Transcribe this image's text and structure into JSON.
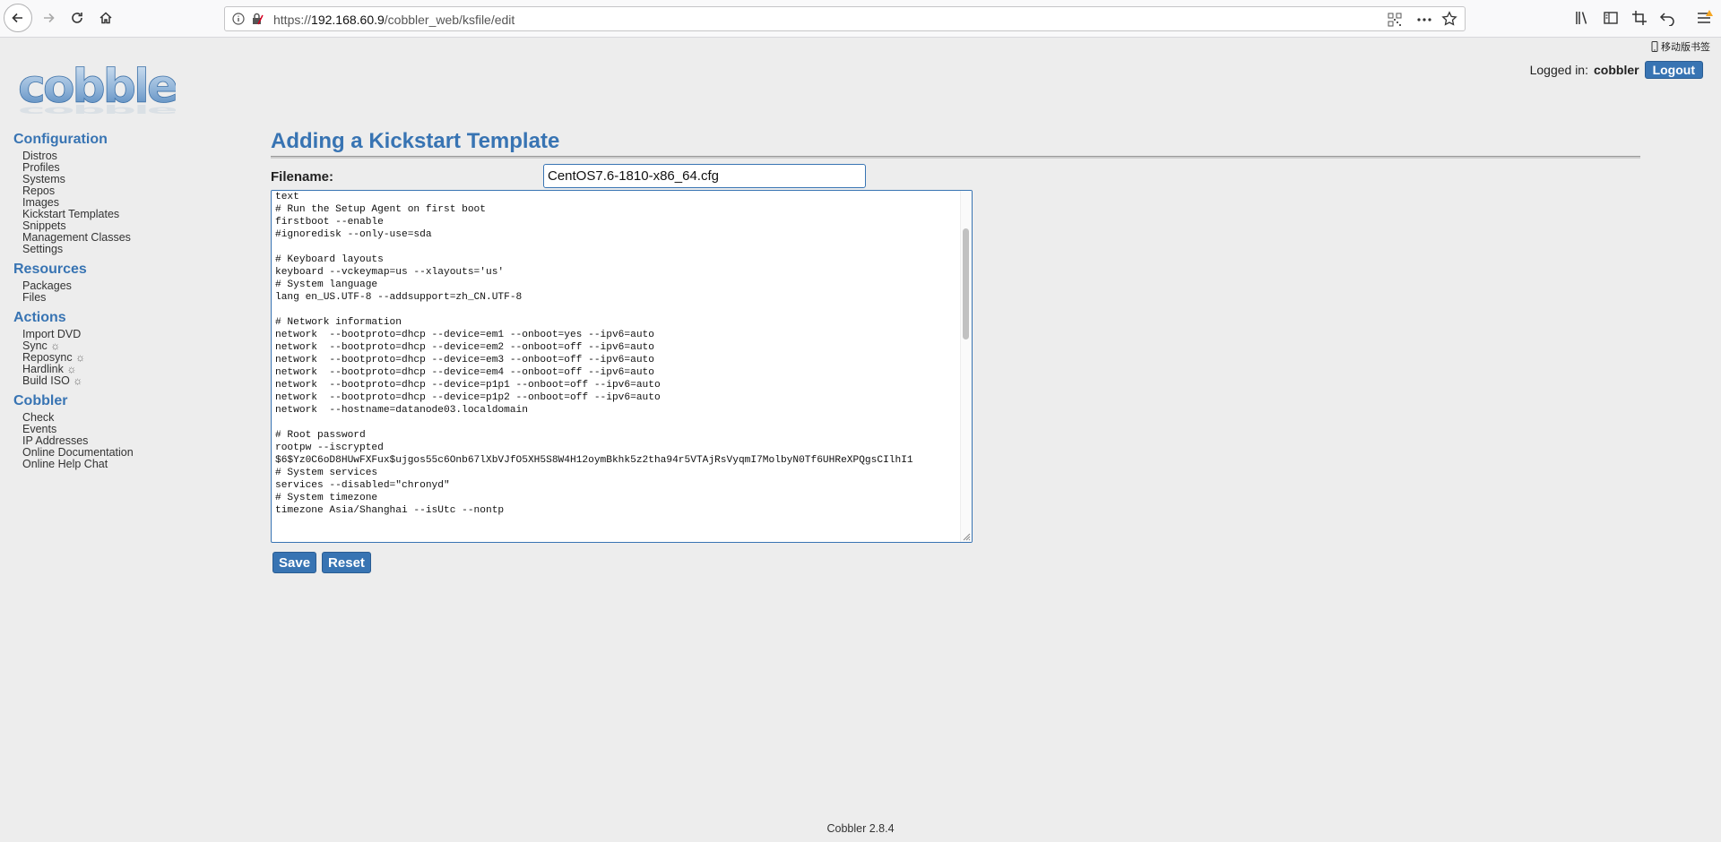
{
  "browser": {
    "url_scheme": "https://",
    "url_host": "192.168.60.9",
    "url_path": "/cobbler_web/ksfile/edit",
    "bookmark_label": "移动版书签"
  },
  "header": {
    "logo_alt": "cobbler",
    "logged_in_label": "Logged in:",
    "username": "cobbler",
    "logout_label": "Logout"
  },
  "sidebar": {
    "sections": [
      {
        "title": "Configuration",
        "items": [
          {
            "label": "Distros"
          },
          {
            "label": "Profiles"
          },
          {
            "label": "Systems"
          },
          {
            "label": "Repos"
          },
          {
            "label": "Images"
          },
          {
            "label": "Kickstart Templates"
          },
          {
            "label": "Snippets"
          },
          {
            "label": "Management Classes"
          },
          {
            "label": "Settings"
          }
        ]
      },
      {
        "title": "Resources",
        "items": [
          {
            "label": "Packages"
          },
          {
            "label": "Files"
          }
        ]
      },
      {
        "title": "Actions",
        "items": [
          {
            "label": "Import DVD",
            "spinner": ""
          },
          {
            "label": "Sync",
            "spinner": "☼"
          },
          {
            "label": "Reposync",
            "spinner": "☼"
          },
          {
            "label": "Hardlink",
            "spinner": "☼"
          },
          {
            "label": "Build ISO",
            "spinner": "☼"
          }
        ]
      },
      {
        "title": "Cobbler",
        "items": [
          {
            "label": "Check"
          },
          {
            "label": "Events"
          },
          {
            "label": "IP Addresses"
          },
          {
            "label": "Online Documentation"
          },
          {
            "label": "Online Help Chat"
          }
        ]
      }
    ]
  },
  "main": {
    "title": "Adding a Kickstart Template",
    "filename_label": "Filename:",
    "filename_value": "CentOS7.6-1810-x86_64.cfg",
    "editor_content": "text\n# Run the Setup Agent on first boot\nfirstboot --enable\n#ignoredisk --only-use=sda\n\n# Keyboard layouts\nkeyboard --vckeymap=us --xlayouts='us'\n# System language\nlang en_US.UTF-8 --addsupport=zh_CN.UTF-8\n\n# Network information\nnetwork  --bootproto=dhcp --device=em1 --onboot=yes --ipv6=auto\nnetwork  --bootproto=dhcp --device=em2 --onboot=off --ipv6=auto\nnetwork  --bootproto=dhcp --device=em3 --onboot=off --ipv6=auto\nnetwork  --bootproto=dhcp --device=em4 --onboot=off --ipv6=auto\nnetwork  --bootproto=dhcp --device=p1p1 --onboot=off --ipv6=auto\nnetwork  --bootproto=dhcp --device=p1p2 --onboot=off --ipv6=auto\nnetwork  --hostname=datanode03.localdomain\n\n# Root password\nrootpw --iscrypted\n$6$Yz0C6oD8HUwFXFux$ujgos55c6Onb67lXbVJfO5XH5S8W4H12oymBkhk5z2tha94r5VTAjRsVyqmI7MolbyN0Tf6UHReXPQgsCIlhI1\n# System services\nservices --disabled=\"chronyd\"\n# System timezone\ntimezone Asia/Shanghai --isUtc --nontp",
    "save_label": "Save",
    "reset_label": "Reset"
  },
  "footer": {
    "version_text": "Cobbler 2.8.4"
  },
  "colors": {
    "accent": "#3874b3",
    "background": "#ededed"
  }
}
